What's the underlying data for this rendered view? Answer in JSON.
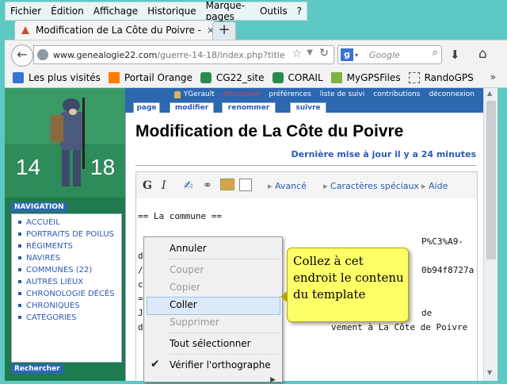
{
  "menubar": [
    "Fichier",
    "Édition",
    "Affichage",
    "Historique",
    "Marque-pages",
    "Outils",
    "?"
  ],
  "tab": {
    "title": "Modification de La Côte du Poivre - Les ...",
    "close": "×",
    "new_tab": "+"
  },
  "navbar": {
    "url_host": "www.genealogie22.com",
    "url_path": "/guerre-14-18/index.php?title",
    "search_engine": "Google",
    "search_placeholder": "Google"
  },
  "bookmarks": [
    {
      "label": "Les plus visités",
      "icon": "search-icon"
    },
    {
      "label": "Portail Orange",
      "icon": "orange-icon"
    },
    {
      "label": "CG22_site",
      "icon": "cg22-icon"
    },
    {
      "label": "CORAIL",
      "icon": "cg22-icon"
    },
    {
      "label": "MyGPSFiles",
      "icon": "gps-icon"
    },
    {
      "label": "RandoGPS",
      "icon": "page-icon"
    }
  ],
  "bookmarks_more": "»",
  "userbar": {
    "user": "YGerault",
    "discussion": "discussion",
    "prefs": "préférences",
    "watchlist": "liste de suivi",
    "contributions": "contributions",
    "logout": "déconnexion"
  },
  "page_tabs": {
    "page": "page",
    "edit": "modifier",
    "rename": "renommer",
    "follow": "suivre"
  },
  "logo": {
    "left": "14",
    "right": "18"
  },
  "sidebar": {
    "nav_title": "NAVIGATION",
    "items": [
      "ACCUEIL",
      "PORTRAITS DE POILUS",
      "RÉGIMENTS",
      "NAVIRES",
      "COMMUNES (22)",
      "AUTRES LIEUX",
      "CHRONOLOGIE DÉCÈS",
      "CHRONIQUES",
      "CATÉGORIES"
    ],
    "search_title": "Rechercher"
  },
  "content": {
    "title": "Modification de La Côte du Poivre",
    "updated": "Dernière mise à jour il y a 24 minutes",
    "toolbar": {
      "bold": "G",
      "italic": "I",
      "advanced": "Avancé",
      "special": "Caractères spéciaux",
      "help": "Aide"
    },
    "code_line1": "== La commune ==",
    "code_frag_a": "P%C3%A9-",
    "code_frag_b": "0b94f8727a",
    "code_frag_c": "de",
    "code_frag_d": "vement à La Côte de Poivre"
  },
  "context_menu": {
    "undo": "Annuler",
    "cut": "Couper",
    "copy": "Copier",
    "paste": "Coller",
    "delete": "Supprimer",
    "select_all": "Tout sélectionner",
    "spellcheck": "Vérifier l'orthographe"
  },
  "callout": "Collez à cet endroit le contenu du template",
  "colors": {
    "accent": "#2c67b0",
    "sidebar": "#1f7a4e",
    "callout": "#ffff66",
    "desktop": "#5ec9c3"
  }
}
